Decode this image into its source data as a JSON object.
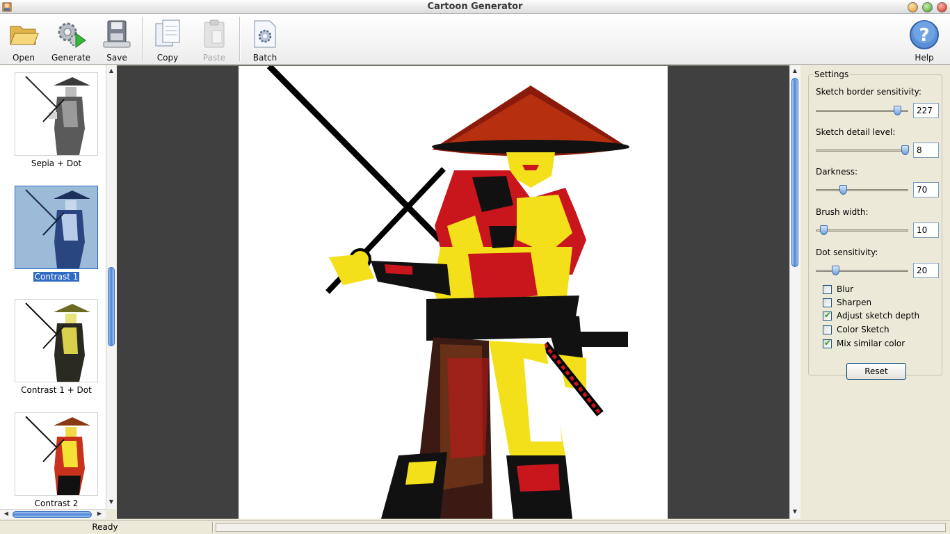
{
  "window": {
    "title": "Cartoon Generator"
  },
  "toolbar": {
    "open_label": "Open",
    "generate_label": "Generate",
    "save_label": "Save",
    "copy_label": "Copy",
    "paste_label": "Paste",
    "batch_label": "Batch",
    "help_label": "Help"
  },
  "thumbnails": [
    {
      "label": "Sepia + Dot",
      "selected": false
    },
    {
      "label": "Contrast 1",
      "selected": true
    },
    {
      "label": "Contrast 1 + Dot",
      "selected": false
    },
    {
      "label": "Contrast 2",
      "selected": false
    }
  ],
  "settings": {
    "title": "Settings",
    "sketch_border_sensitivity": {
      "label": "Sketch border sensitivity:",
      "value": "227",
      "fraction": 0.88
    },
    "sketch_detail_level": {
      "label": "Sketch detail level:",
      "value": "8",
      "fraction": 0.96
    },
    "darkness": {
      "label": "Darkness:",
      "value": "70",
      "fraction": 0.29
    },
    "brush_width": {
      "label": "Brush width:",
      "value": "10",
      "fraction": 0.08
    },
    "dot_sensitivity": {
      "label": "Dot sensitivity:",
      "value": "20",
      "fraction": 0.21
    },
    "checkboxes": [
      {
        "label": "Blur",
        "checked": false
      },
      {
        "label": "Sharpen",
        "checked": false
      },
      {
        "label": "Adjust sketch depth",
        "checked": true
      },
      {
        "label": "Color Sketch",
        "checked": false
      },
      {
        "label": "Mix similar color",
        "checked": true
      }
    ],
    "reset_label": "Reset"
  },
  "status": {
    "text": "Ready"
  },
  "colors": {
    "selection": "#316ac5",
    "canvas_bg": "#404040",
    "panel_bg": "#ece9d8"
  }
}
